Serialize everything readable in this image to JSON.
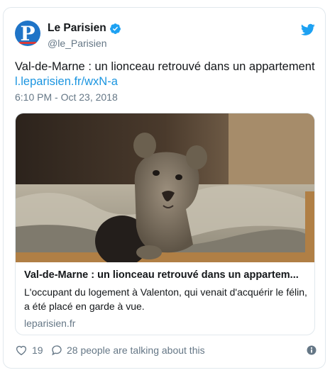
{
  "account": {
    "name": "Le Parisien",
    "handle": "@le_Parisien",
    "avatar_letter": "P"
  },
  "tweet": {
    "text": "Val-de-Marne : un lionceau retrouvé dans un appartement",
    "link": "l.leparisien.fr/wxN-a",
    "timestamp": "6:10 PM - Oct 23, 2018"
  },
  "card": {
    "title": "Val-de-Marne : un lionceau retrouvé dans un appartem...",
    "description": "L'occupant du logement à Valenton, qui venait d'acquérir le félin, a été placé en garde à vue.",
    "domain": "leparisien.fr"
  },
  "footer": {
    "likes": "19",
    "talking": "28 people are talking about this"
  },
  "colors": {
    "accent": "#1da1f2",
    "link": "#1b95e0",
    "secondary_text": "#657786"
  },
  "icons": [
    "verified-badge-icon",
    "twitter-bird-icon",
    "heart-icon",
    "reply-bubble-icon",
    "info-icon"
  ]
}
